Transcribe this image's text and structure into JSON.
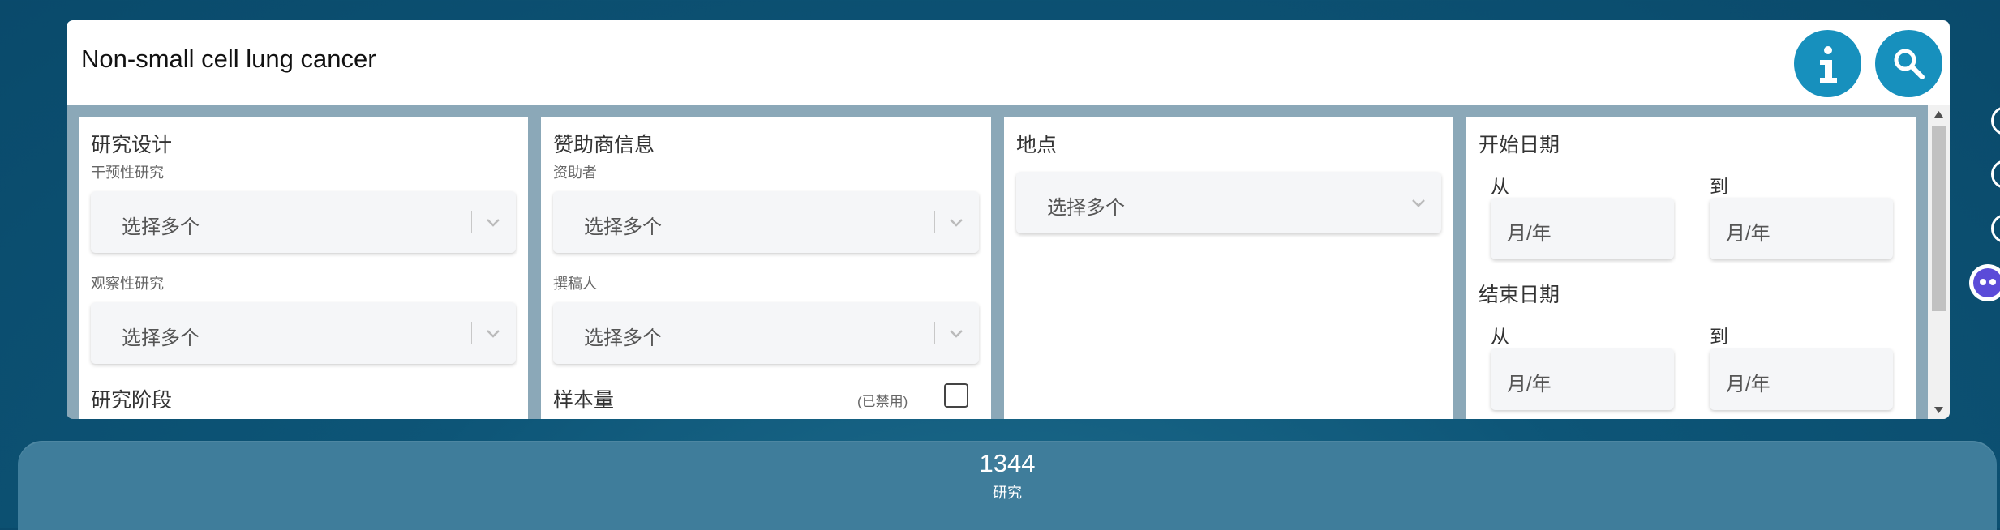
{
  "search": {
    "query": "Non-small cell lung cancer"
  },
  "buttons": {
    "info_icon": "info-icon",
    "search_icon": "search-icon"
  },
  "panels": {
    "design": {
      "title": "研究设计",
      "interventional_label": "干预性研究",
      "interventional_placeholder": "选择多个",
      "observational_label": "观察性研究",
      "observational_placeholder": "选择多个",
      "phase_title": "研究阶段"
    },
    "sponsor": {
      "title": "赞助商信息",
      "funder_label": "资助者",
      "funder_placeholder": "选择多个",
      "author_label": "撰稿人",
      "author_placeholder": "选择多个",
      "sample_title": "样本量",
      "disabled_label": "(已禁用)"
    },
    "location": {
      "title": "地点",
      "placeholder": "选择多个"
    },
    "dates": {
      "start_title": "开始日期",
      "start_from": "从",
      "start_to": "到",
      "start_from_placeholder": "月/年",
      "start_to_placeholder": "月/年",
      "end_title": "结束日期",
      "end_from": "从",
      "end_to": "到",
      "end_from_placeholder": "月/年",
      "end_to_placeholder": "月/年"
    }
  },
  "results": {
    "count": "1344",
    "label": "研究"
  },
  "colors": {
    "accent": "#1790bd",
    "panel_bg": "#8ba8b8",
    "results_bar": "#3f7d9b"
  }
}
